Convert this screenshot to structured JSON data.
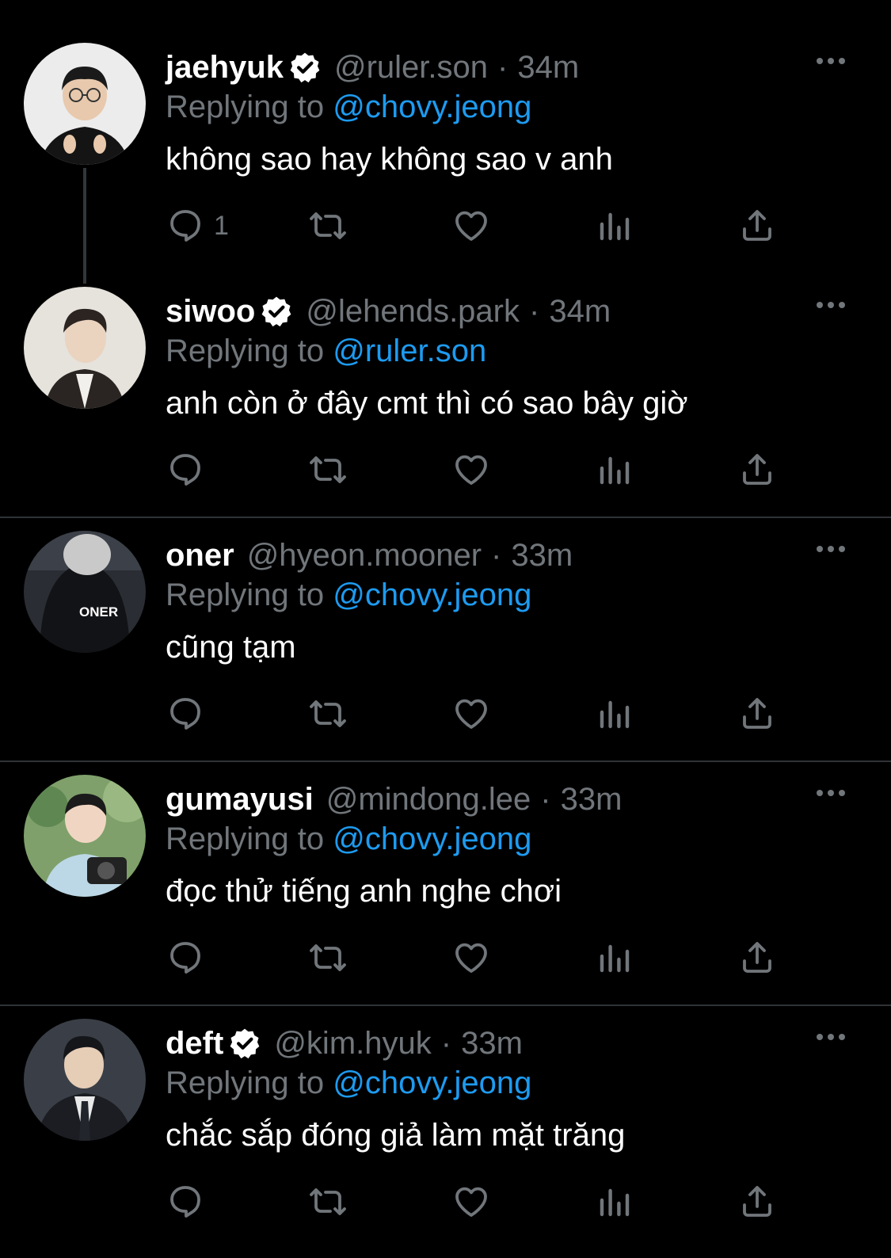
{
  "tweets": [
    {
      "name": "jaehyuk",
      "verified": true,
      "handle": "@ruler.son",
      "dot": "·",
      "time": "34m",
      "replying_prefix": "Replying to ",
      "replying_to": "@chovy.jeong",
      "text": "không sao hay không sao v anh",
      "reply_count": "1"
    },
    {
      "name": "siwoo",
      "verified": true,
      "handle": "@lehends.park",
      "dot": "·",
      "time": "34m",
      "replying_prefix": "Replying to ",
      "replying_to": "@ruler.son",
      "text": "anh còn ở đây cmt thì có sao bây giờ",
      "reply_count": ""
    },
    {
      "name": "oner",
      "verified": false,
      "handle": "@hyeon.mooner",
      "dot": "·",
      "time": "33m",
      "replying_prefix": "Replying to ",
      "replying_to": "@chovy.jeong",
      "text": "cũng tạm",
      "reply_count": "",
      "avatar_jersey_text": "ONER"
    },
    {
      "name": "gumayusi",
      "verified": false,
      "handle": "@mindong.lee",
      "dot": "·",
      "time": "33m",
      "replying_prefix": "Replying to ",
      "replying_to": "@chovy.jeong",
      "text": "đọc thử tiếng anh nghe chơi",
      "reply_count": ""
    },
    {
      "name": "deft",
      "verified": true,
      "handle": "@kim.hyuk",
      "dot": "·",
      "time": "33m",
      "replying_prefix": "Replying to ",
      "replying_to": "@chovy.jeong",
      "text": "chắc sắp đóng giả làm mặt trăng",
      "reply_count": ""
    }
  ],
  "colors": {
    "background": "#000000",
    "text": "#ffffff",
    "muted": "#71767b",
    "link": "#1d9bf0",
    "divider": "#2f3336"
  },
  "icons": [
    "reply-icon",
    "retweet-icon",
    "like-icon",
    "views-icon",
    "share-icon",
    "more-icon",
    "verified-icon"
  ]
}
